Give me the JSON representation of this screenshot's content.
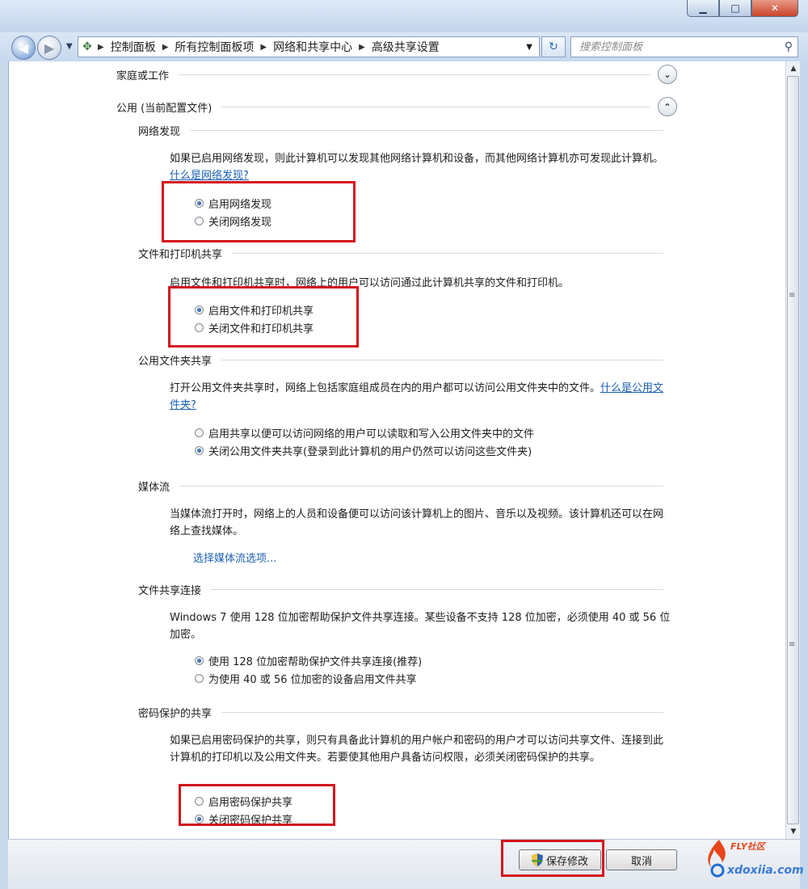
{
  "window": {
    "minimize": "▁",
    "maximize": "□",
    "close": "✕"
  },
  "address": {
    "crumbs": [
      "控制面板",
      "所有控制面板项",
      "网络和共享中心",
      "高级共享设置"
    ]
  },
  "search": {
    "placeholder": "搜索控制面板"
  },
  "groups": {
    "home": {
      "title": "家庭或工作"
    },
    "public": {
      "title": "公用 (当前配置文件)"
    }
  },
  "sections": {
    "discovery": {
      "title": "网络发现",
      "desc": "如果已启用网络发现，则此计算机可以发现其他网络计算机和设备，而其他网络计算机亦可发现此计算机。",
      "link": "什么是网络发现?",
      "options": [
        "启用网络发现",
        "关闭网络发现"
      ],
      "selected": 0
    },
    "printer": {
      "title": "文件和打印机共享",
      "desc": "启用文件和打印机共享时，网络上的用户可以访问通过此计算机共享的文件和打印机。",
      "options": [
        "启用文件和打印机共享",
        "关闭文件和打印机共享"
      ],
      "selected": 0
    },
    "publicfolder": {
      "title": "公用文件夹共享",
      "desc": "打开公用文件夹共享时，网络上包括家庭组成员在内的用户都可以访问公用文件夹中的文件。",
      "link": "什么是公用文件夹?",
      "options": [
        "启用共享以便可以访问网络的用户可以读取和写入公用文件夹中的文件",
        "关闭公用文件夹共享(登录到此计算机的用户仍然可以访问这些文件夹)"
      ],
      "selected": 1
    },
    "media": {
      "title": "媒体流",
      "desc": "当媒体流打开时，网络上的人员和设备便可以访问该计算机上的图片、音乐以及视频。该计算机还可以在网络上查找媒体。",
      "link": "选择媒体流选项..."
    },
    "connections": {
      "title": "文件共享连接",
      "desc": "Windows 7 使用 128 位加密帮助保护文件共享连接。某些设备不支持 128 位加密，必须使用 40 或 56 位加密。",
      "options": [
        "使用 128 位加密帮助保护文件共享连接(推荐)",
        "为使用 40 或 56 位加密的设备启用文件共享"
      ],
      "selected": 0
    },
    "password": {
      "title": "密码保护的共享",
      "desc": "如果已启用密码保护的共享，则只有具备此计算机的用户帐户和密码的用户才可以访问共享文件、连接到此计算机的打印机以及公用文件夹。若要使其他用户具备访问权限，必须关闭密码保护的共享。",
      "options": [
        "启用密码保护共享",
        "关闭密码保护共享"
      ],
      "selected": 1
    }
  },
  "buttons": {
    "save": "保存修改",
    "cancel": "取消"
  },
  "logo": {
    "name": "FLY社区",
    "url": "xdoxiia.com"
  },
  "colors": {
    "highlight": "#d4141e",
    "link": "#1a5fb4"
  }
}
